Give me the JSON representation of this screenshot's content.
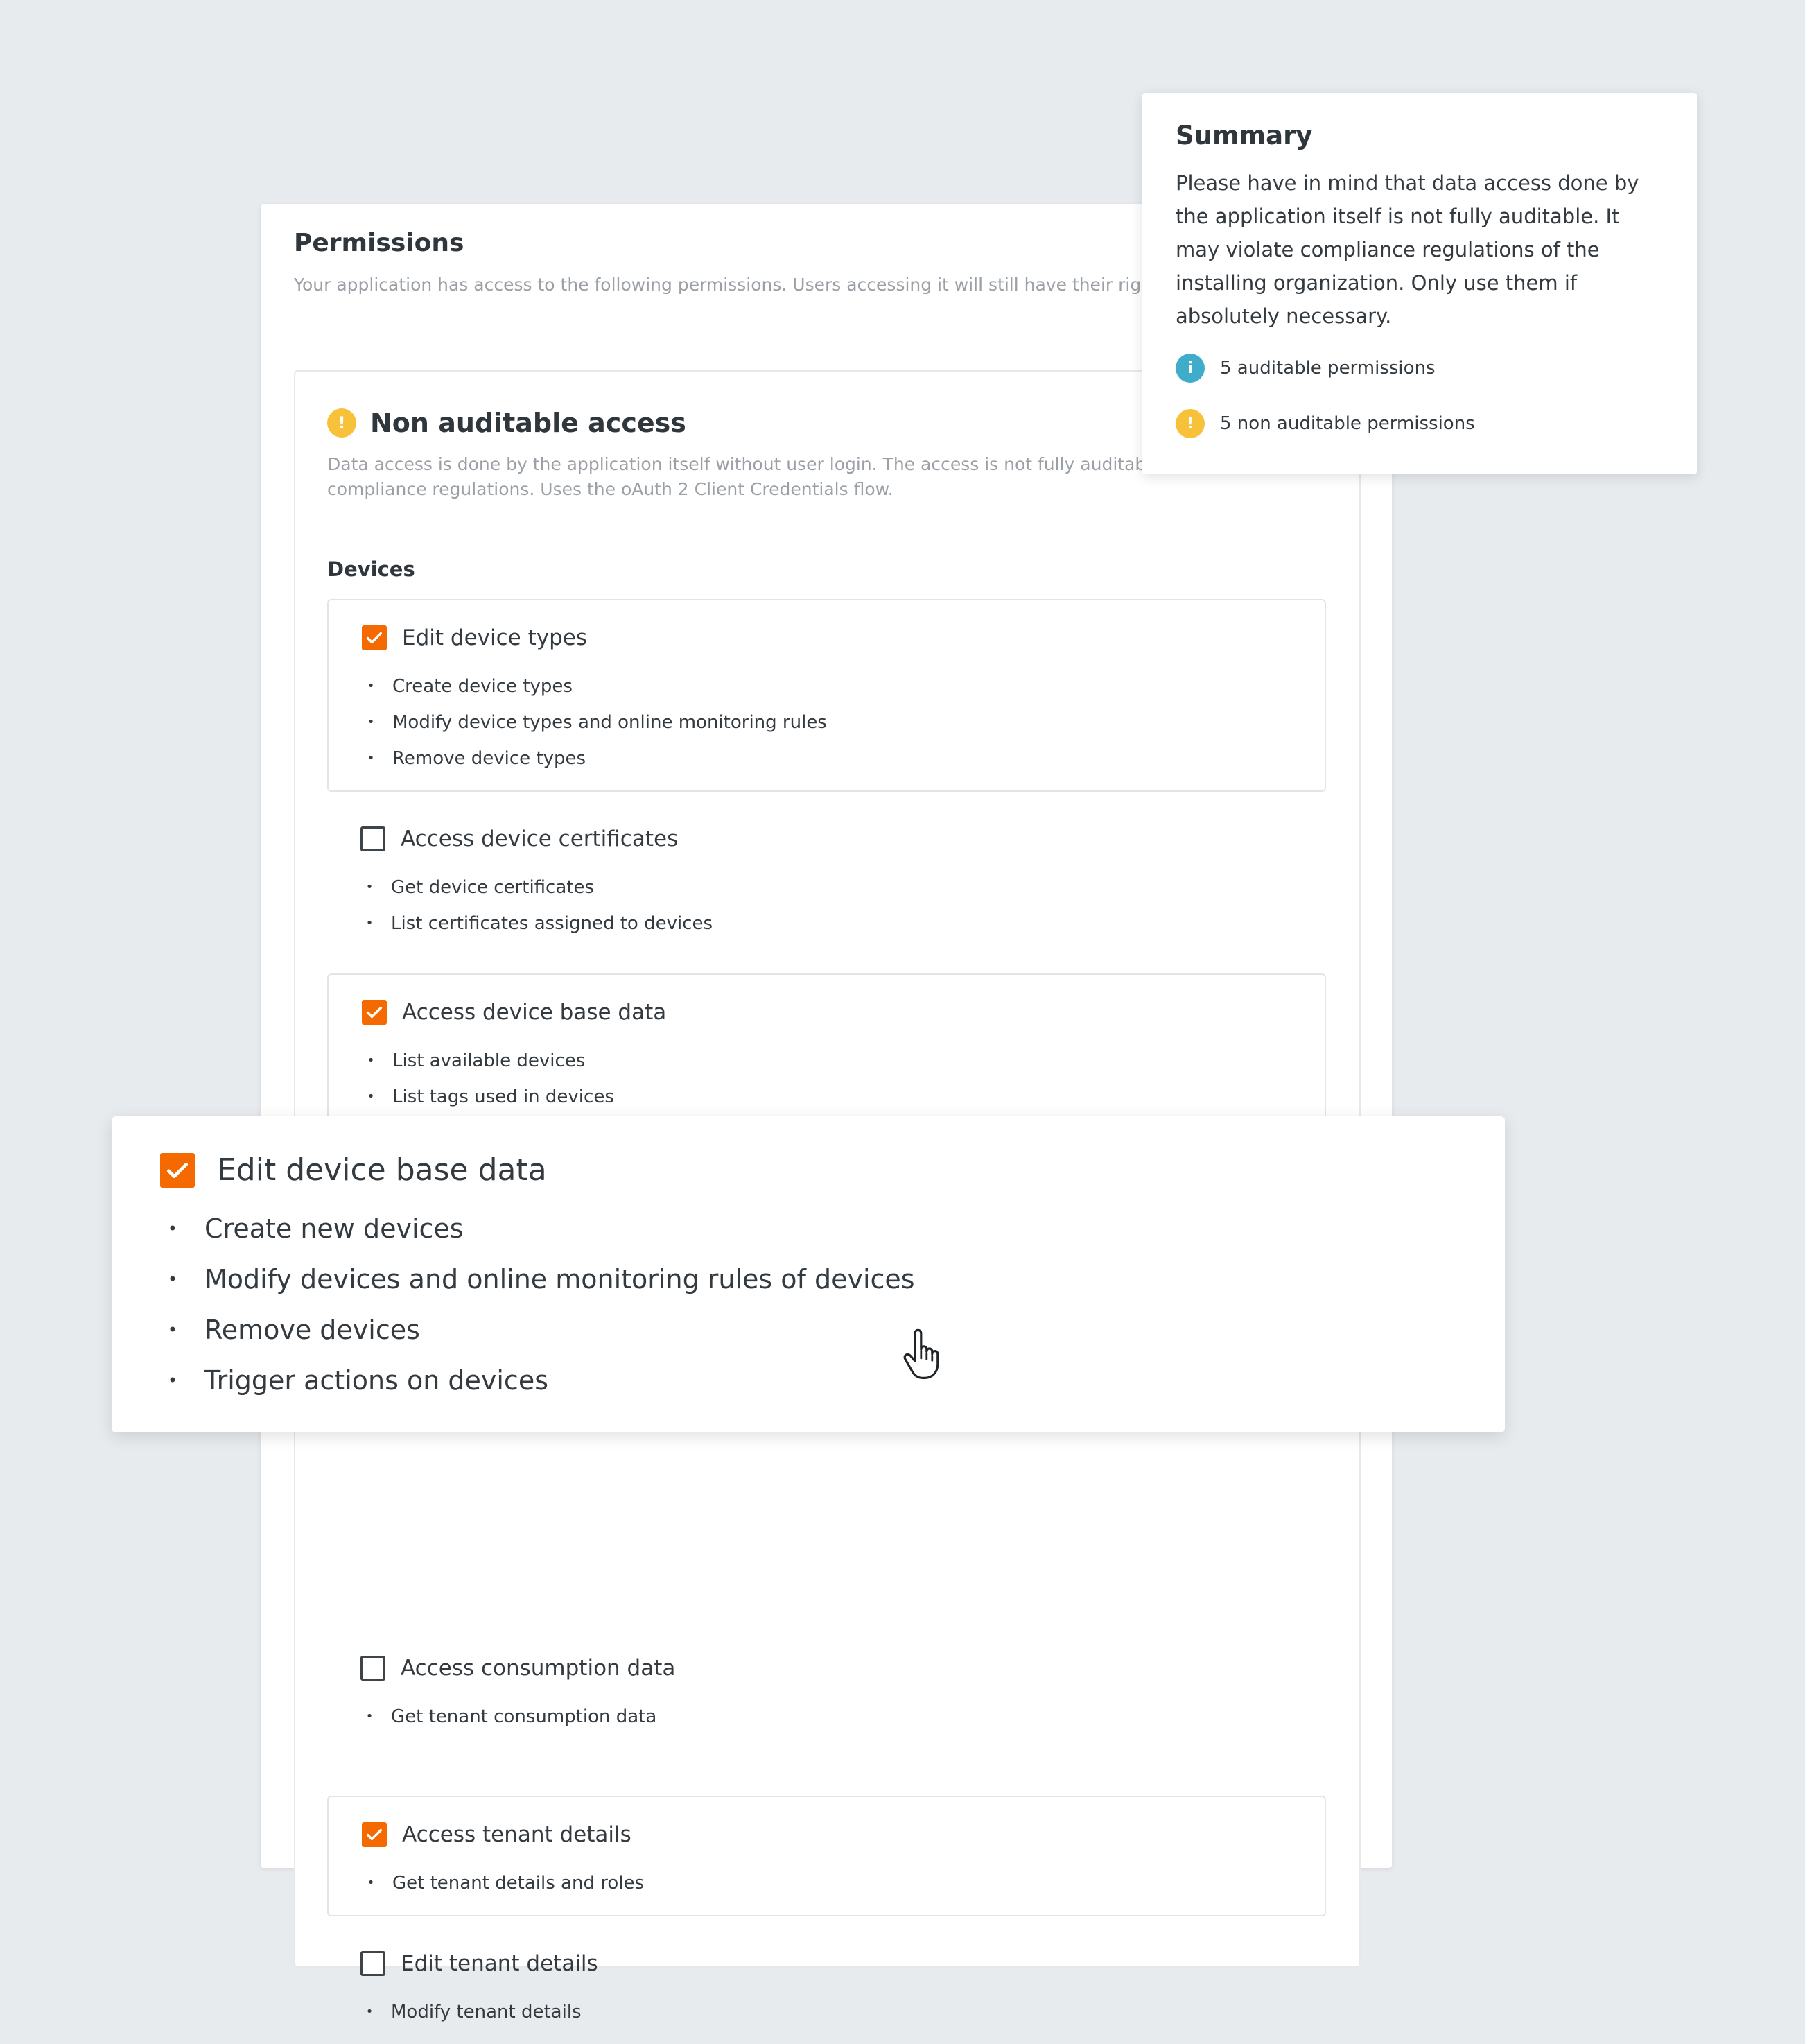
{
  "permissions_card": {
    "title": "Permissions",
    "description": "Your application has access to the following permissions. Users accessing it will still have their rights restricted by their role."
  },
  "non_auditable": {
    "icon": "warning-icon",
    "icon_glyph": "!",
    "title": "Non auditable access",
    "description": "Data access is done by the application itself without user login. The access is not fully auditable and may violate compliance regulations. Uses the oAuth 2 Client Credentials flow.",
    "group_label": "Devices",
    "permissions": [
      {
        "label": "Edit device types",
        "checked": true,
        "items": [
          "Create device types",
          "Modify device types and online monitoring rules",
          "Remove device types"
        ]
      },
      {
        "label": "Access device certificates",
        "checked": false,
        "items": [
          "Get device certificates",
          "List certificates assigned to devices"
        ]
      },
      {
        "label": "Access device base data",
        "checked": true,
        "items": [
          "List available devices",
          "List tags used in devices"
        ]
      },
      {
        "label": "Access consumption data",
        "checked": false,
        "items": [
          "Get tenant consumption data"
        ]
      },
      {
        "label": "Access tenant details",
        "checked": true,
        "items": [
          "Get tenant details and roles"
        ]
      },
      {
        "label": "Edit tenant details",
        "checked": false,
        "items": [
          "Modify tenant details"
        ]
      }
    ]
  },
  "zoomed_permission": {
    "label": "Edit device base data",
    "checked": true,
    "items": [
      "Create new devices",
      "Modify devices and online monitoring rules of devices",
      "Remove devices",
      "Trigger actions on devices"
    ]
  },
  "summary": {
    "title": "Summary",
    "text": "Please have in mind that data access done by the application itself is not fully auditable. It may violate compliance regulations of the installing organization. Only use them if absolutely necessary.",
    "rows": [
      {
        "icon": "info-icon",
        "glyph": "i",
        "text": "5 auditable permissions"
      },
      {
        "icon": "warning-icon",
        "glyph": "!",
        "text": "5 non auditable permissions"
      }
    ]
  },
  "colors": {
    "accent": "#f56a00",
    "warning": "#f8c13a",
    "info": "#3fadc9",
    "background": "#e8ebee"
  }
}
